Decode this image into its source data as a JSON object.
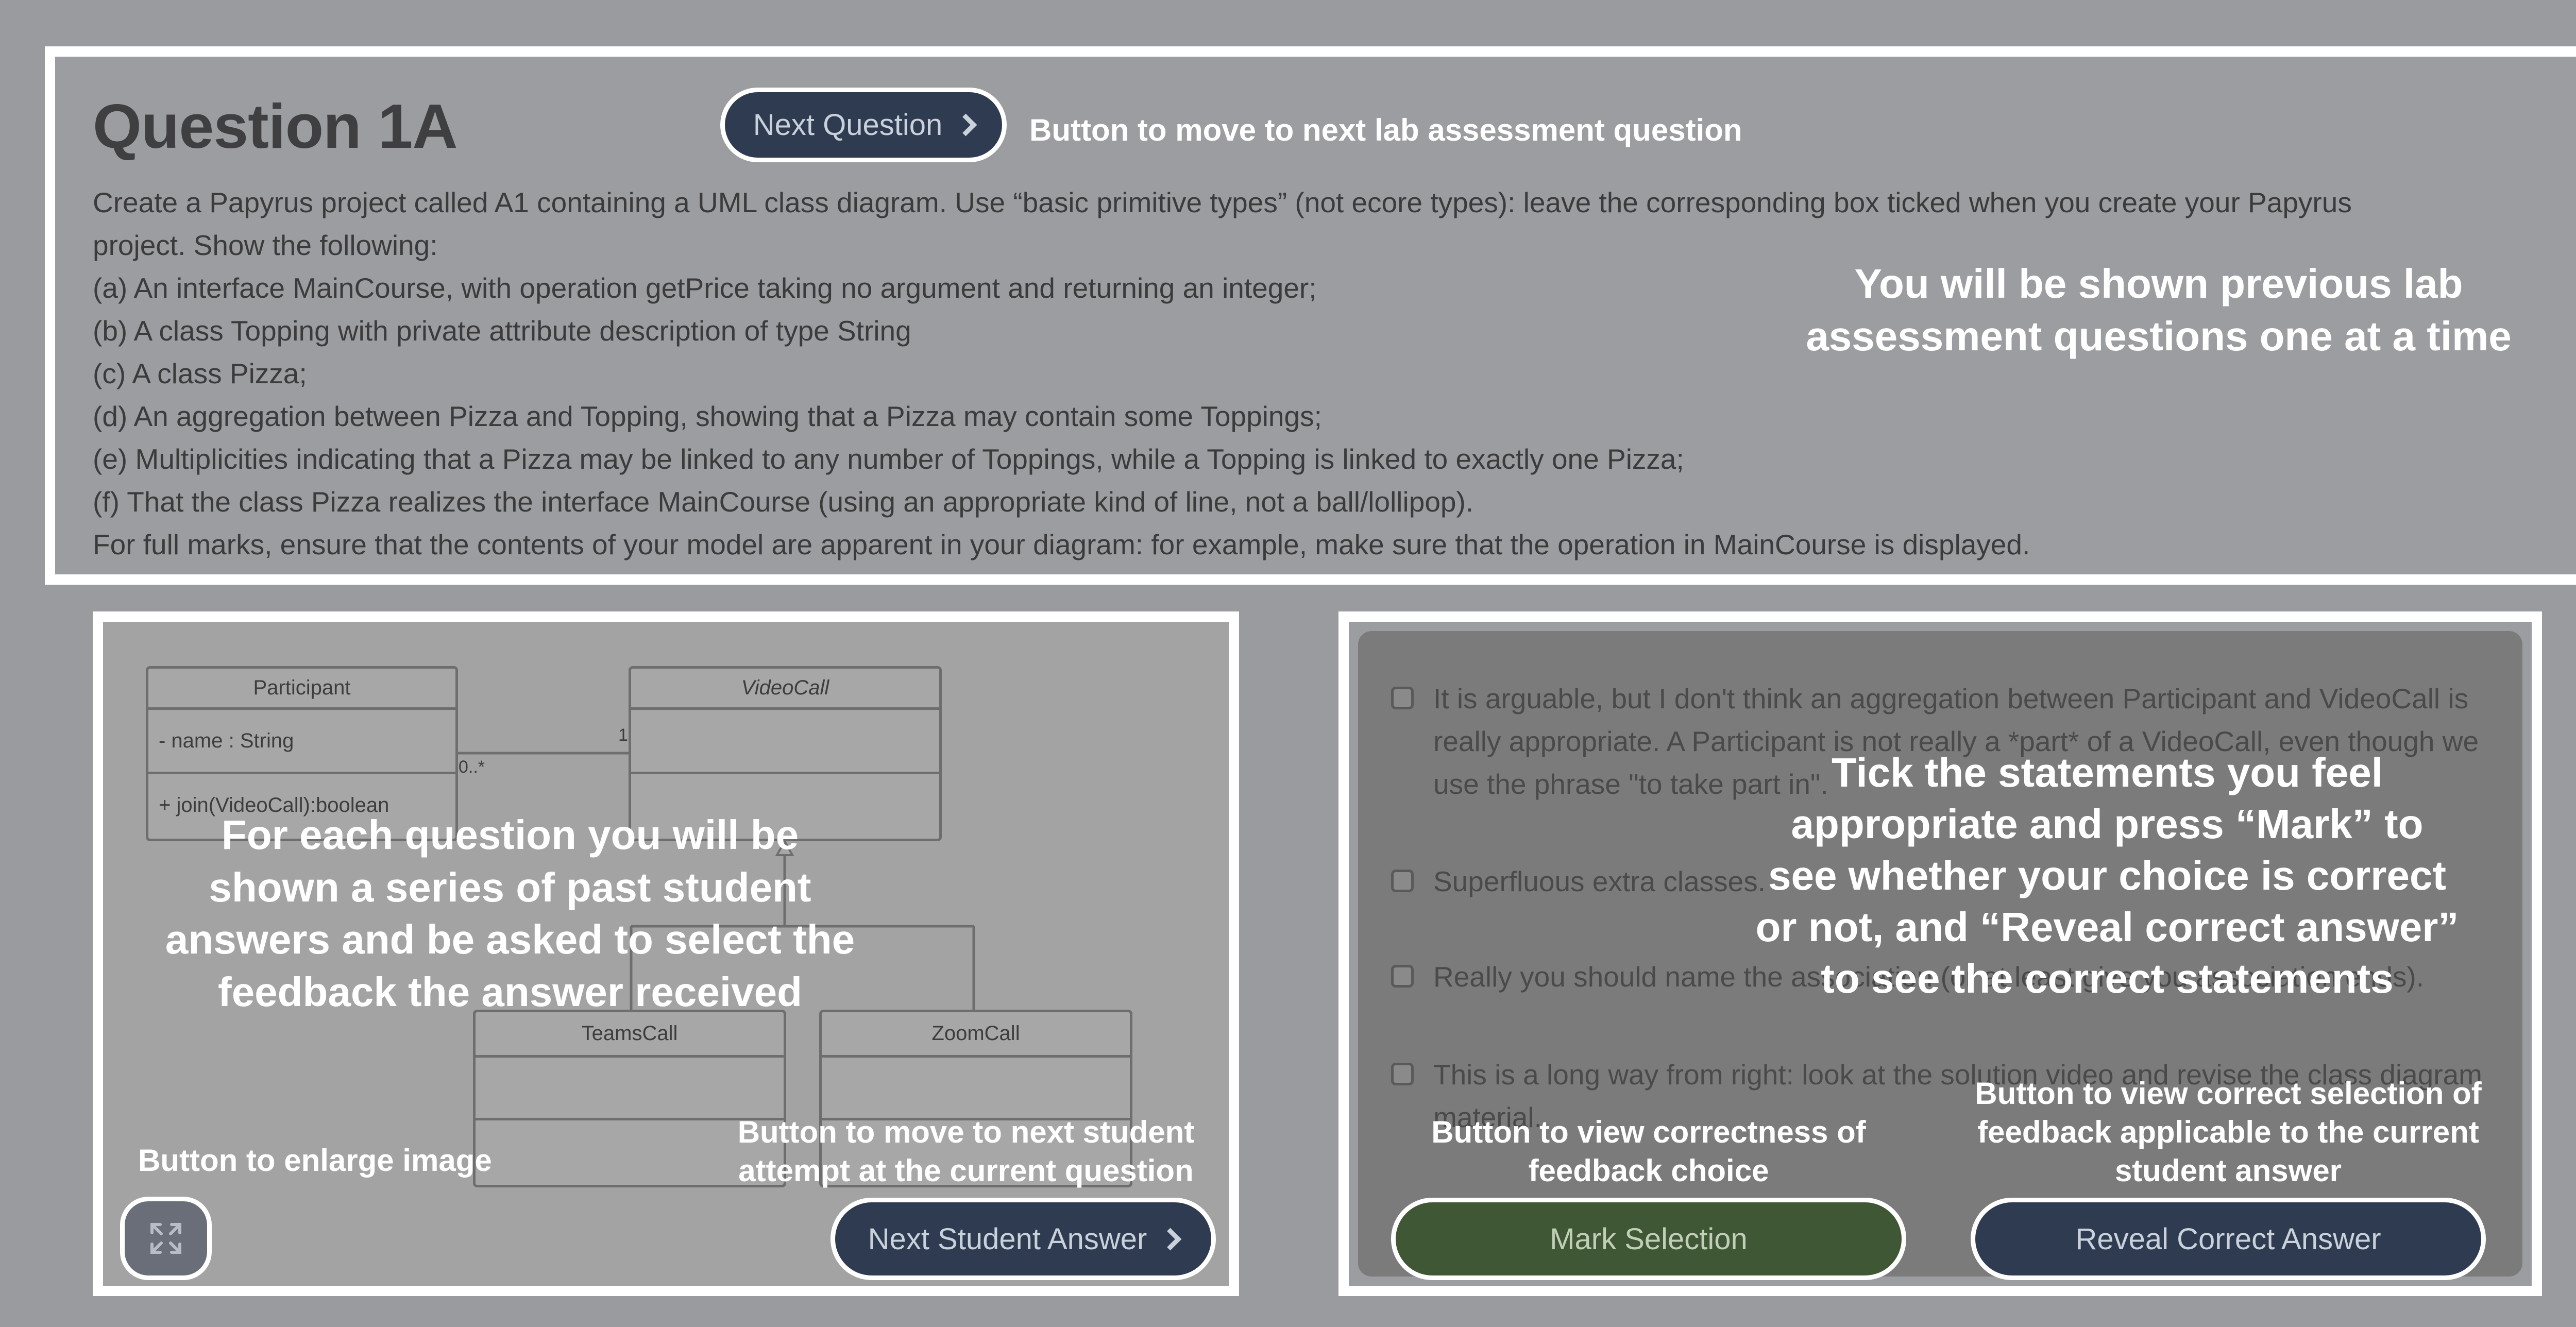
{
  "question": {
    "title": "Question 1A",
    "next_question_label": "Next Question",
    "body_lines": [
      "Create a Papyrus project called A1 containing a UML class diagram. Use “basic primitive types” (not ecore types): leave the corresponding box ticked when you create your Papyrus",
      "project. Show the following:",
      "(a) An interface MainCourse, with operation getPrice taking no argument and returning an integer;",
      "(b) A class Topping with private attribute description of type String",
      "(c) A class Pizza;",
      "(d) An aggregation between Pizza and Topping, showing that a Pizza may contain some Toppings;",
      "(e) Multiplicities indicating that a Pizza may be linked to any number of Toppings, while a Topping is linked to exactly one Pizza;",
      "(f) That the class Pizza realizes the interface MainCourse (using an appropriate kind of line, not a ball/lollipop).",
      "For full marks, ensure that the contents of your model are apparent in your diagram: for example, make sure that the operation in MainCourse is displayed."
    ]
  },
  "annotations": {
    "next_question": "Button to move to next lab assessment question",
    "questions_one_at_a_time": [
      "You will be shown previous lab",
      "assessment questions one at a time"
    ],
    "student_answers": [
      "For each question you will be",
      "shown a series of past student",
      "answers and be asked to select the",
      "feedback the answer received"
    ],
    "enlarge_image": "Button to enlarge image",
    "next_student": [
      "Button to move to next student",
      "attempt at the current question"
    ],
    "tick_statements": [
      "Tick the statements you feel",
      "appropriate and press “Mark” to",
      "see whether your choice is correct",
      "or not, and “Reveal correct answer”",
      "to see the correct statements"
    ],
    "mark_selection": [
      "Button to view correctness of",
      "feedback choice"
    ],
    "reveal_answer": [
      "Button to view correct selection of",
      "feedback applicable to the current",
      "student answer"
    ]
  },
  "diagram": {
    "participant": {
      "name": "Participant",
      "attribute": "- name : String",
      "operation": "+ join(VideoCall):boolean"
    },
    "videocall": {
      "name": "VideoCall"
    },
    "teamscall": {
      "name": "TeamsCall"
    },
    "zoomcall": {
      "name": "ZoomCall"
    },
    "mult_left": "0..*",
    "mult_right": "1"
  },
  "student_nav": {
    "next_student_label": "Next Student Answer",
    "expand_icon": "expand-icon"
  },
  "feedback": {
    "items": [
      "It is arguable, but I don't think an aggregation between Participant and VideoCall is really appropriate. A Participant is not really a *part* of a VideoCall, even though we use the phrase \"to take part in\".",
      "Superfluous extra classes.",
      "Really you should name the association (or at least give you association ends).",
      "This is a long way from right: look at the solution video and revise the class diagram material."
    ],
    "mark_label": "Mark Selection",
    "reveal_label": "Reveal Correct Answer"
  },
  "colors": {
    "navy": "#2f3b50",
    "green": "#3f5735",
    "page_bg": "#9a9b9e",
    "feedback_panel": "#7b7b7b"
  }
}
